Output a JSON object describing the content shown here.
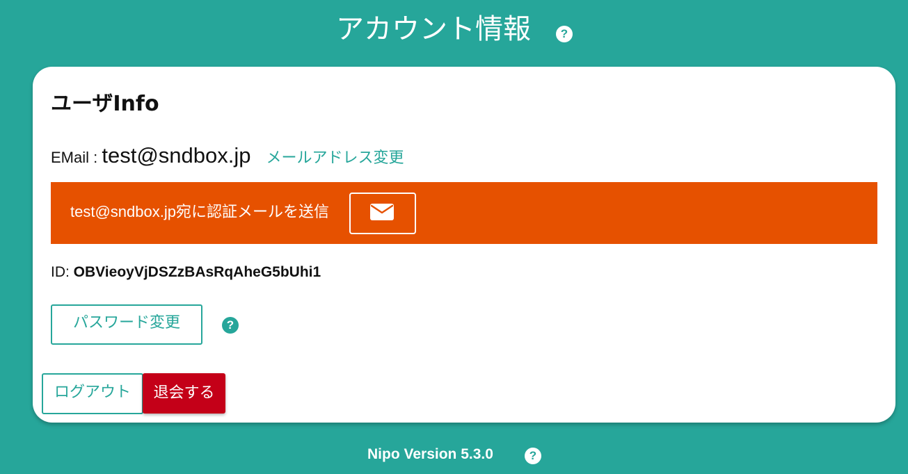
{
  "header": {
    "title": "アカウント情報",
    "help_icon": "?"
  },
  "card": {
    "title": "ユーザInfo",
    "email": {
      "label": "EMail : ",
      "value": "test@sndbox.jp",
      "change_link": "メールアドレス変更"
    },
    "verification": {
      "text": "test@sndbox.jp宛に認証メールを送信",
      "button_icon": "mail-icon",
      "banner_color": "#e65100"
    },
    "id": {
      "label": "ID: ",
      "value": "OBVieoyVjDSZzBAsRqAheG5bUhi1"
    },
    "password_button": "パスワード変更",
    "password_help_icon": "?",
    "logout_button": "ログアウト",
    "withdraw_button": "退会する"
  },
  "footer": {
    "version": "Nipo Version 5.3.0",
    "help_icon": "?"
  },
  "colors": {
    "background": "#26a69a",
    "accent": "#26a69a",
    "danger": "#c40018",
    "warning": "#e65100"
  }
}
